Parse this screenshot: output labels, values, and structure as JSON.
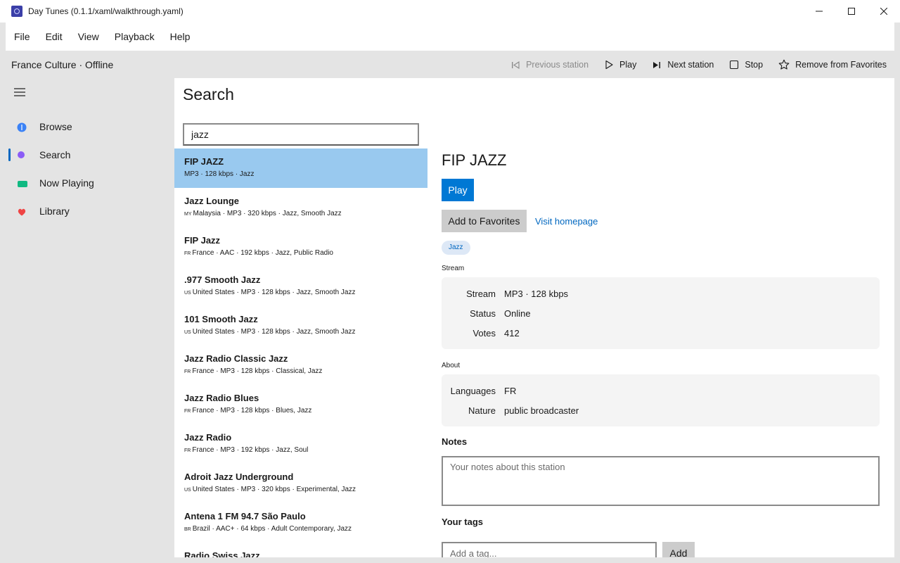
{
  "window": {
    "title": "Day Tunes (0.1.1/xaml/walkthrough.yaml)",
    "app_icon": "radio-app-icon"
  },
  "menu": [
    "File",
    "Edit",
    "View",
    "Playback",
    "Help"
  ],
  "toolbar": {
    "now_status": "France Culture · Offline",
    "previous_label": "Previous station",
    "play_label": "Play",
    "next_label": "Next station",
    "stop_label": "Stop",
    "remove_fav_label": "Remove from Favorites"
  },
  "sidebar": {
    "items": [
      {
        "label": "Browse",
        "icon": "browse-icon",
        "color": "#3b82f6",
        "selected": false
      },
      {
        "label": "Search",
        "icon": "search-icon",
        "color": "#8b5cf6",
        "selected": true
      },
      {
        "label": "Now Playing",
        "icon": "now-playing-icon",
        "color": "#10b981",
        "selected": false
      },
      {
        "label": "Library",
        "icon": "heart-icon",
        "color": "#ef4444",
        "selected": false
      }
    ]
  },
  "main": {
    "title": "Search",
    "search_value": "jazz",
    "results": [
      {
        "name": "FIP JAZZ",
        "cc": "",
        "meta": "MP3 · 128 kbps · Jazz",
        "selected": true
      },
      {
        "name": "Jazz Lounge",
        "cc": "MY",
        "meta": "Malaysia · MP3 · 320 kbps · Jazz, Smooth Jazz",
        "selected": false
      },
      {
        "name": "FIP Jazz",
        "cc": "FR",
        "meta": "France · AAC · 192 kbps · Jazz, Public Radio",
        "selected": false
      },
      {
        "name": ".977 Smooth Jazz",
        "cc": "US",
        "meta": "United States · MP3 · 128 kbps · Jazz, Smooth Jazz",
        "selected": false
      },
      {
        "name": "101 Smooth Jazz",
        "cc": "US",
        "meta": "United States · MP3 · 128 kbps · Jazz, Smooth Jazz",
        "selected": false
      },
      {
        "name": "Jazz Radio Classic Jazz",
        "cc": "FR",
        "meta": "France · MP3 · 128 kbps · Classical, Jazz",
        "selected": false
      },
      {
        "name": "Jazz Radio Blues",
        "cc": "FR",
        "meta": "France · MP3 · 128 kbps · Blues, Jazz",
        "selected": false
      },
      {
        "name": "Jazz Radio",
        "cc": "FR",
        "meta": "France · MP3 · 192 kbps · Jazz, Soul",
        "selected": false
      },
      {
        "name": "Adroit Jazz Underground",
        "cc": "US",
        "meta": "United States · MP3 · 320 kbps · Experimental, Jazz",
        "selected": false
      },
      {
        "name": "Antena 1 FM 94.7 São Paulo",
        "cc": "BR",
        "meta": "Brazil · AAC+ · 64 kbps · Adult Contemporary, Jazz",
        "selected": false
      },
      {
        "name": "Radio Swiss Jazz",
        "cc": "",
        "meta": "",
        "selected": false
      }
    ]
  },
  "detail": {
    "title": "FIP JAZZ",
    "play_label": "Play",
    "fav_label": "Add to Favorites",
    "homepage_label": "Visit homepage",
    "tag": "Jazz",
    "stream_section": "Stream",
    "stream_rows": [
      {
        "key": "Stream",
        "value": "MP3 · 128 kbps"
      },
      {
        "key": "Status",
        "value": "Online"
      },
      {
        "key": "Votes",
        "value": "412"
      }
    ],
    "about_section": "About",
    "about_rows": [
      {
        "key": "Languages",
        "value": "FR"
      },
      {
        "key": "Nature",
        "value": "public broadcaster"
      }
    ],
    "notes_label": "Notes",
    "notes_placeholder": "Your notes about this station",
    "tags_label": "Your tags",
    "tag_placeholder": "Add a tag...",
    "add_label": "Add"
  },
  "colors": {
    "accent": "#0078d4",
    "selection": "#99c9ef",
    "link": "#0067c0"
  }
}
